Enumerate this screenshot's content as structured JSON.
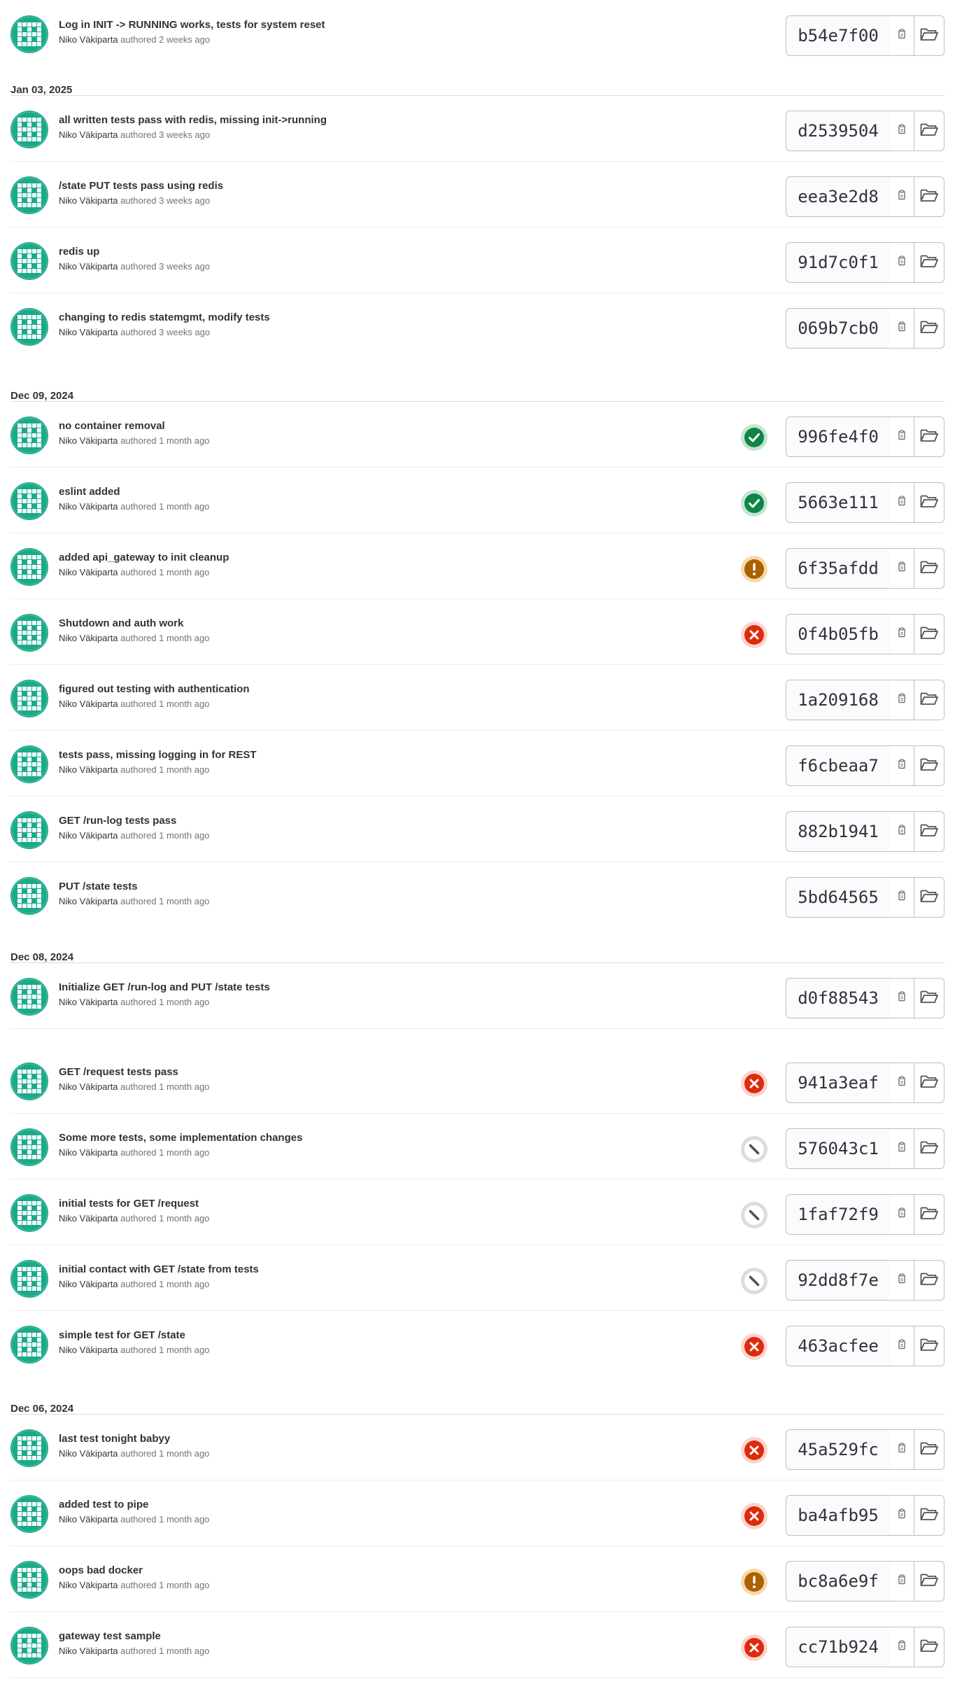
{
  "colors": {
    "avatar_teal": "#1aaa8a",
    "success": "#108548",
    "warning": "#ab6100",
    "failed": "#dd2b0e",
    "canceled": "#535158",
    "border": "#dcdcde"
  },
  "authored_word": "authored",
  "groups": [
    {
      "date": "",
      "commits": [
        {
          "title": "Log in INIT -> RUNNING works, tests for system reset",
          "author": "Niko Väkiparta",
          "time": "2 weeks ago",
          "sha": "b54e7f00",
          "status": "none"
        }
      ]
    },
    {
      "date": "Jan 03, 2025",
      "commits": [
        {
          "title": "all written tests pass with redis, missing init->running",
          "author": "Niko Väkiparta",
          "time": "3 weeks ago",
          "sha": "d2539504",
          "status": "none"
        },
        {
          "title": "/state PUT tests pass using redis",
          "author": "Niko Väkiparta",
          "time": "3 weeks ago",
          "sha": "eea3e2d8",
          "status": "none"
        },
        {
          "title": "redis up",
          "author": "Niko Väkiparta",
          "time": "3 weeks ago",
          "sha": "91d7c0f1",
          "status": "none"
        },
        {
          "title": "changing to redis statemgmt, modify tests",
          "author": "Niko Väkiparta",
          "time": "3 weeks ago",
          "sha": "069b7cb0",
          "status": "none"
        }
      ]
    },
    {
      "date": "Dec 09, 2024",
      "commits": [
        {
          "title": "no container removal",
          "author": "Niko Väkiparta",
          "time": "1 month ago",
          "sha": "996fe4f0",
          "status": "success"
        },
        {
          "title": "eslint added",
          "author": "Niko Väkiparta",
          "time": "1 month ago",
          "sha": "5663e111",
          "status": "success"
        },
        {
          "title": "added api_gateway to init cleanup",
          "author": "Niko Väkiparta",
          "time": "1 month ago",
          "sha": "6f35afdd",
          "status": "warning"
        },
        {
          "title": "Shutdown and auth work",
          "author": "Niko Väkiparta",
          "time": "1 month ago",
          "sha": "0f4b05fb",
          "status": "failed"
        },
        {
          "title": "figured out testing with authentication",
          "author": "Niko Väkiparta",
          "time": "1 month ago",
          "sha": "1a209168",
          "status": "none"
        },
        {
          "title": "tests pass, missing logging in for REST",
          "author": "Niko Väkiparta",
          "time": "1 month ago",
          "sha": "f6cbeaa7",
          "status": "none"
        },
        {
          "title": "GET /run-log tests pass",
          "author": "Niko Väkiparta",
          "time": "1 month ago",
          "sha": "882b1941",
          "status": "none"
        },
        {
          "title": "PUT /state tests",
          "author": "Niko Väkiparta",
          "time": "1 month ago",
          "sha": "5bd64565",
          "status": "none"
        }
      ]
    },
    {
      "date": "Dec 08, 2024",
      "commits": [
        {
          "title": "Initialize GET /run-log and PUT /state tests",
          "author": "Niko Väkiparta",
          "time": "1 month ago",
          "sha": "d0f88543",
          "status": "none"
        },
        {
          "title": "GET /request tests pass",
          "author": "Niko Väkiparta",
          "time": "1 month ago",
          "sha": "941a3eaf",
          "status": "failed"
        },
        {
          "title": "Some more tests, some implementation changes",
          "author": "Niko Väkiparta",
          "time": "1 month ago",
          "sha": "576043c1",
          "status": "canceled"
        },
        {
          "title": "initial tests for GET /request",
          "author": "Niko Väkiparta",
          "time": "1 month ago",
          "sha": "1faf72f9",
          "status": "canceled"
        },
        {
          "title": "initial contact with GET /state from tests",
          "author": "Niko Väkiparta",
          "time": "1 month ago",
          "sha": "92dd8f7e",
          "status": "canceled"
        },
        {
          "title": "simple test for GET /state",
          "author": "Niko Väkiparta",
          "time": "1 month ago",
          "sha": "463acfee",
          "status": "failed"
        }
      ]
    },
    {
      "date": "Dec 06, 2024",
      "commits": [
        {
          "title": "last test tonight babyy",
          "author": "Niko Väkiparta",
          "time": "1 month ago",
          "sha": "45a529fc",
          "status": "failed"
        },
        {
          "title": "added test to pipe",
          "author": "Niko Väkiparta",
          "time": "1 month ago",
          "sha": "ba4afb95",
          "status": "failed"
        },
        {
          "title": "oops bad docker",
          "author": "Niko Väkiparta",
          "time": "1 month ago",
          "sha": "bc8a6e9f",
          "status": "warning"
        },
        {
          "title": "gateway test sample",
          "author": "Niko Väkiparta",
          "time": "1 month ago",
          "sha": "cc71b924",
          "status": "failed"
        }
      ]
    }
  ]
}
